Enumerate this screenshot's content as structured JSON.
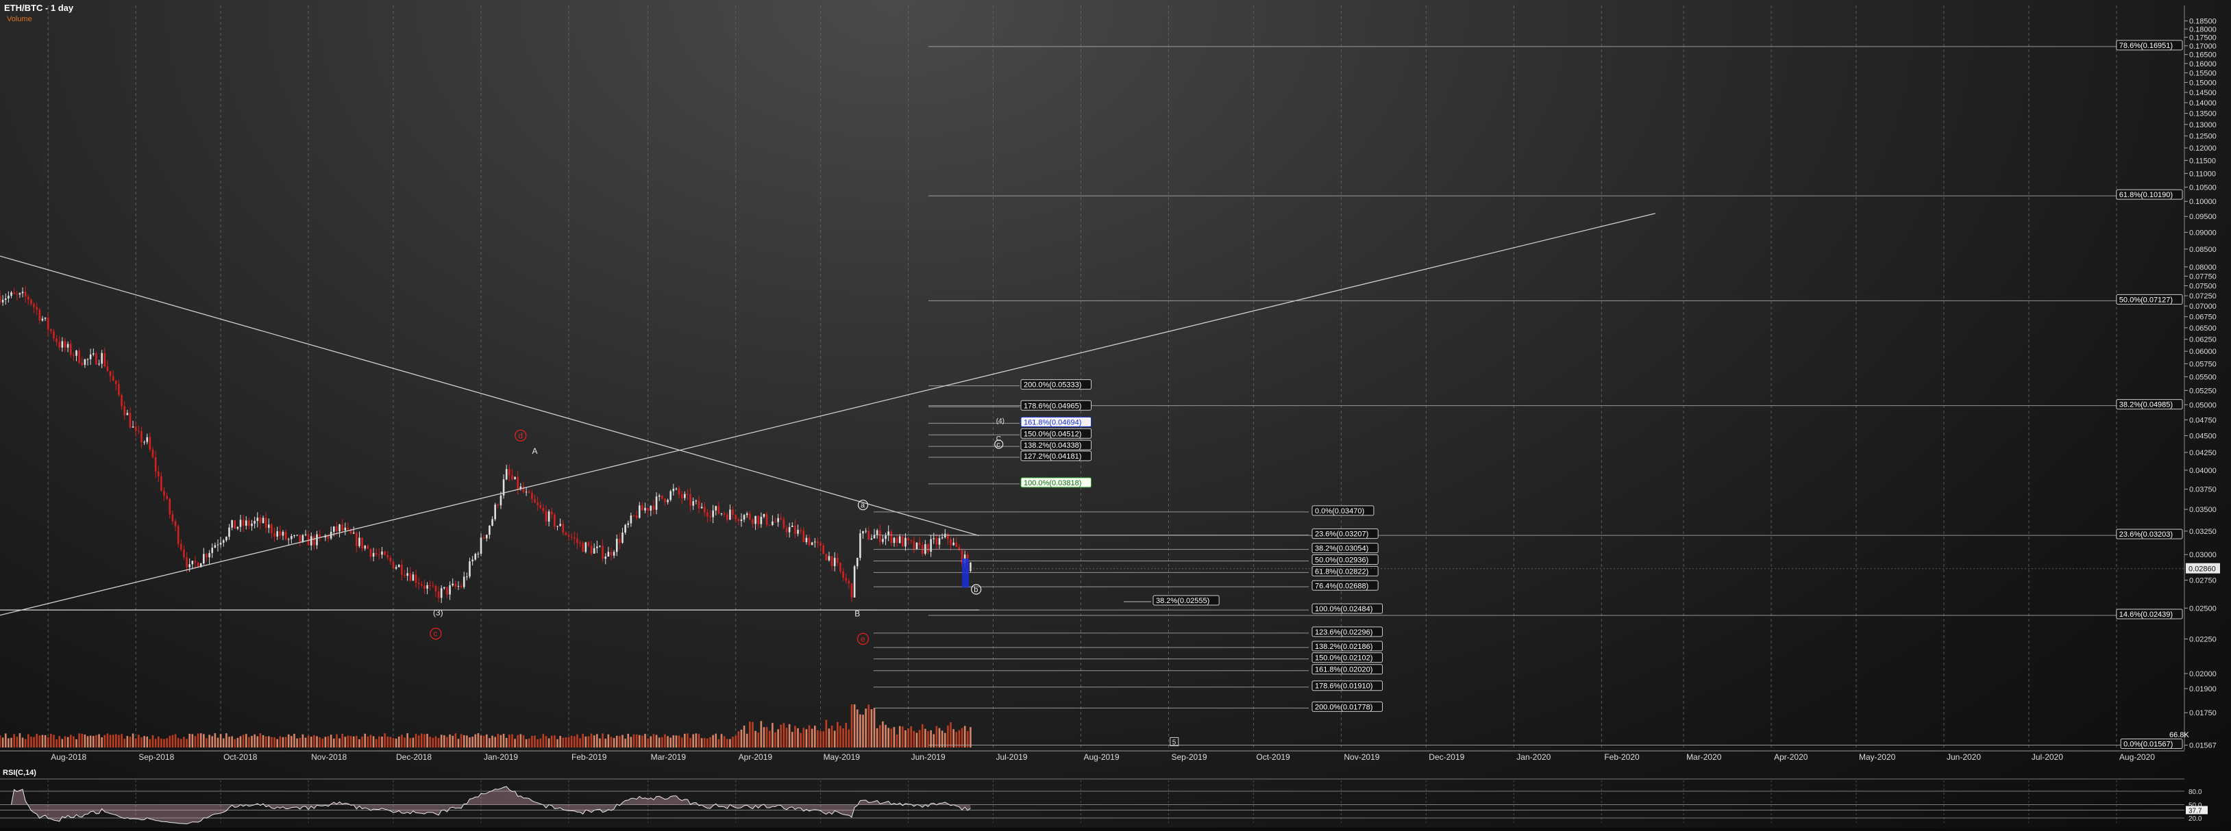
{
  "header": {
    "title": "ETH/BTC - 1 day",
    "volume_label": "Volume"
  },
  "rsi_label": "RSI(C,14)",
  "chart_data": {
    "type": "candlestick",
    "title": "ETH/BTC - 1 day",
    "y_scale": "log",
    "ylim": [
      0.0154,
      0.195
    ],
    "x_range": [
      "2018-07-15",
      "2020-08-25"
    ],
    "y_ticks": [
      "0.01567",
      "0.01750",
      "0.01900",
      "0.02000",
      "0.02250",
      "0.02500",
      "0.02750",
      "0.03000",
      "0.03250",
      "0.03500",
      "0.03750",
      "0.04000",
      "0.04250",
      "0.04500",
      "0.04750",
      "0.05000",
      "0.05250",
      "0.05500",
      "0.05750",
      "0.06000",
      "0.06250",
      "0.06500",
      "0.06750",
      "0.07000",
      "0.07250",
      "0.07500",
      "0.07750",
      "0.08000",
      "0.08500",
      "0.09000",
      "0.09500",
      "0.10000",
      "0.10500",
      "0.11000",
      "0.11500",
      "0.12000",
      "0.12500",
      "0.13000",
      "0.13500",
      "0.14000",
      "0.14500",
      "0.15000",
      "0.15500",
      "0.16000",
      "0.16500",
      "0.17000",
      "0.17500",
      "0.18000",
      "0.18500"
    ],
    "x_ticks": [
      {
        "label": "Aug-2018",
        "date": "2018-08-01"
      },
      {
        "label": "Sep-2018",
        "date": "2018-09-01"
      },
      {
        "label": "Oct-2018",
        "date": "2018-10-01"
      },
      {
        "label": "Nov-2018",
        "date": "2018-11-01"
      },
      {
        "label": "Dec-2018",
        "date": "2018-12-01"
      },
      {
        "label": "Jan-2019",
        "date": "2019-01-01"
      },
      {
        "label": "Feb-2019",
        "date": "2019-02-01"
      },
      {
        "label": "Mar-2019",
        "date": "2019-03-01"
      },
      {
        "label": "Apr-2019",
        "date": "2019-04-01"
      },
      {
        "label": "May-2019",
        "date": "2019-05-01"
      },
      {
        "label": "Jun-2019",
        "date": "2019-06-01"
      },
      {
        "label": "Jul-2019",
        "date": "2019-07-01"
      },
      {
        "label": "Aug-2019",
        "date": "2019-08-01"
      },
      {
        "label": "Sep-2019",
        "date": "2019-09-01"
      },
      {
        "label": "Oct-2019",
        "date": "2019-10-01"
      },
      {
        "label": "Nov-2019",
        "date": "2019-11-01"
      },
      {
        "label": "Dec-2019",
        "date": "2019-12-01"
      },
      {
        "label": "Jan-2020",
        "date": "2020-01-01"
      },
      {
        "label": "Feb-2020",
        "date": "2020-02-01"
      },
      {
        "label": "Mar-2020",
        "date": "2020-03-01"
      },
      {
        "label": "Apr-2020",
        "date": "2020-04-01"
      },
      {
        "label": "May-2020",
        "date": "2020-05-01"
      },
      {
        "label": "Jun-2020",
        "date": "2020-06-01"
      },
      {
        "label": "Jul-2020",
        "date": "2020-07-01"
      },
      {
        "label": "Aug-2020",
        "date": "2020-08-01"
      }
    ],
    "price_path": [
      {
        "date": "2018-07-15",
        "price": 0.0725
      },
      {
        "date": "2018-07-25",
        "price": 0.072
      },
      {
        "date": "2018-08-05",
        "price": 0.0615
      },
      {
        "date": "2018-08-14",
        "price": 0.058
      },
      {
        "date": "2018-08-20",
        "price": 0.059
      },
      {
        "date": "2018-09-01",
        "price": 0.045
      },
      {
        "date": "2018-09-05",
        "price": 0.044
      },
      {
        "date": "2018-09-13",
        "price": 0.0345
      },
      {
        "date": "2018-09-20",
        "price": 0.0285
      },
      {
        "date": "2018-10-05",
        "price": 0.033
      },
      {
        "date": "2018-10-15",
        "price": 0.0335
      },
      {
        "date": "2018-10-25",
        "price": 0.0315
      },
      {
        "date": "2018-11-05",
        "price": 0.0315
      },
      {
        "date": "2018-11-12",
        "price": 0.0328
      },
      {
        "date": "2018-11-25",
        "price": 0.03
      },
      {
        "date": "2018-12-05",
        "price": 0.0285
      },
      {
        "date": "2018-12-16",
        "price": 0.0262
      },
      {
        "date": "2018-12-25",
        "price": 0.027
      },
      {
        "date": "2019-01-05",
        "price": 0.034
      },
      {
        "date": "2019-01-10",
        "price": 0.0395
      },
      {
        "date": "2019-01-20",
        "price": 0.0355
      },
      {
        "date": "2019-02-05",
        "price": 0.031
      },
      {
        "date": "2019-02-15",
        "price": 0.03
      },
      {
        "date": "2019-02-25",
        "price": 0.0345
      },
      {
        "date": "2019-03-10",
        "price": 0.0372
      },
      {
        "date": "2019-03-20",
        "price": 0.035
      },
      {
        "date": "2019-04-05",
        "price": 0.0342
      },
      {
        "date": "2019-04-15",
        "price": 0.0335
      },
      {
        "date": "2019-04-25",
        "price": 0.032
      },
      {
        "date": "2019-05-05",
        "price": 0.0295
      },
      {
        "date": "2019-05-12",
        "price": 0.0265
      },
      {
        "date": "2019-05-15",
        "price": 0.032
      },
      {
        "date": "2019-05-25",
        "price": 0.032
      },
      {
        "date": "2019-06-05",
        "price": 0.0305
      },
      {
        "date": "2019-06-15",
        "price": 0.0318
      },
      {
        "date": "2019-06-23",
        "price": 0.0286
      }
    ],
    "trendlines": [
      {
        "name": "descending-resistance",
        "from": {
          "date": "2018-07-15",
          "price": 0.083
        },
        "to": {
          "date": "2019-06-26",
          "price": 0.032
        }
      },
      {
        "name": "ascending-support",
        "from": {
          "date": "2018-07-15",
          "price": 0.0244
        },
        "to": {
          "date": "2020-02-20",
          "price": 0.096
        }
      }
    ],
    "support_line": {
      "date_from": "2018-07-15",
      "date_to": "2019-06-26",
      "price": 0.02484
    },
    "fib_right": [
      {
        "label": "78.6%(0.16951)",
        "value": 0.16951
      },
      {
        "label": "61.8%(0.10190)",
        "value": 0.1019
      },
      {
        "label": "50.0%(0.07127)",
        "value": 0.07127
      },
      {
        "label": "38.2%(0.04985)",
        "value": 0.04985
      },
      {
        "label": "23.6%(0.03203)",
        "value": 0.03203
      },
      {
        "label": "14.6%(0.02439)",
        "value": 0.02439
      },
      {
        "label": "0.0%(0.01567)",
        "value": 0.01567
      }
    ],
    "fib_mid": [
      {
        "label": "0.0%(0.03470)",
        "value": 0.0347
      },
      {
        "label": "23.6%(0.03207)",
        "value": 0.03207
      },
      {
        "label": "38.2%(0.03054)",
        "value": 0.03054
      },
      {
        "label": "50.0%(0.02936)",
        "value": 0.02936
      },
      {
        "label": "61.8%(0.02822)",
        "value": 0.02822
      },
      {
        "label": "76.4%(0.02688)",
        "value": 0.02688
      },
      {
        "label": "100.0%(0.02484)",
        "value": 0.02484
      },
      {
        "label": "123.6%(0.02296)",
        "value": 0.02296
      },
      {
        "label": "138.2%(0.02186)",
        "value": 0.02186
      },
      {
        "label": "150.0%(0.02102)",
        "value": 0.02102
      },
      {
        "label": "161.8%(0.02020)",
        "value": 0.0202
      },
      {
        "label": "178.6%(0.01910)",
        "value": 0.0191
      },
      {
        "label": "200.0%(0.01778)",
        "value": 0.01778
      }
    ],
    "fib_ext": [
      {
        "label": "200.0%(0.05333)",
        "value": 0.05333
      },
      {
        "label": "178.6%(0.04965)",
        "value": 0.04965
      },
      {
        "label": "161.8%(0.04694)",
        "value": 0.04694,
        "highlight": "blue"
      },
      {
        "label": "150.0%(0.04512)",
        "value": 0.04512
      },
      {
        "label": "138.2%(0.04338)",
        "value": 0.04338
      },
      {
        "label": "127.2%(0.04181)",
        "value": 0.04181
      },
      {
        "label": "100.0%(0.03818)",
        "value": 0.03818,
        "highlight": "green"
      }
    ],
    "retrace_label": {
      "label": "38.2%(0.02555)",
      "value": 0.02555
    },
    "current_price": {
      "label": "0.02860",
      "value": 0.0286
    },
    "volume_max": {
      "label": "66.8K"
    },
    "wave_labels": [
      {
        "text": "d",
        "date": "2019-01-15",
        "price": 0.0446,
        "style": "red-circle"
      },
      {
        "text": "A",
        "date": "2019-01-20",
        "price": 0.0423,
        "style": "plain"
      },
      {
        "text": "(3)",
        "date": "2018-12-16",
        "price": 0.0244,
        "style": "plain"
      },
      {
        "text": "c",
        "date": "2018-12-16",
        "price": 0.0227,
        "style": "red-circle"
      },
      {
        "text": "a",
        "date": "2019-05-16",
        "price": 0.0352,
        "style": "white-circle"
      },
      {
        "text": "B",
        "date": "2019-05-14",
        "price": 0.0243,
        "style": "plain"
      },
      {
        "text": "e",
        "date": "2019-05-16",
        "price": 0.0223,
        "style": "red-circle"
      },
      {
        "text": "b",
        "date": "2019-06-25",
        "price": 0.0264,
        "style": "white-circle"
      },
      {
        "text": "(4)",
        "date": "2019-07-03",
        "price": 0.047,
        "style": "plain-small"
      },
      {
        "text": "C",
        "date": "2019-07-03",
        "price": 0.0442,
        "style": "plain-small"
      },
      {
        "text": "c",
        "date": "2019-07-03",
        "price": 0.0433,
        "style": "white-circle-small"
      },
      {
        "text": "5",
        "date": "2019-09-03",
        "price": 0.0156,
        "style": "box-small"
      }
    ],
    "rsi": {
      "name": "RSI(C,14)",
      "levels": [
        {
          "label": "80.0",
          "value": 80
        },
        {
          "label": "50.0",
          "value": 50
        },
        {
          "label": "37.7",
          "value": 37.7
        },
        {
          "label": "20.0",
          "value": 20
        }
      ]
    },
    "colors": {
      "up": "#e0e0e0",
      "down": "#d42020",
      "grid": "#6a6a6a",
      "fib": "#bdbdbd",
      "wave_red": "#e02020",
      "volume_up": "#f09070",
      "volume_down": "#d04020",
      "highlight_blue": "#1a2fd8",
      "highlight_green": "#2a9a2a"
    }
  }
}
